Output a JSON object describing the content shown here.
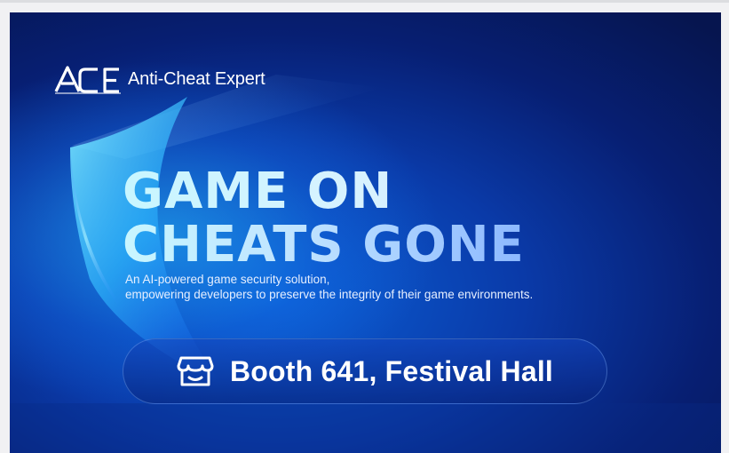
{
  "brand": {
    "logo_letters": "ACE",
    "name": "Anti-Cheat Expert"
  },
  "headline": {
    "line1": "GAME ON",
    "line2": "CHEATS GONE"
  },
  "subtitle": {
    "line1": "An AI-powered game security solution,",
    "line2": "empowering developers to preserve the integrity of their game environments."
  },
  "booth": {
    "icon": "storefront-icon",
    "label": "Booth 641, Festival Hall"
  },
  "colors": {
    "background_deep": "#06154f",
    "background_mid": "#0b5fd6",
    "glow": "#28beff",
    "headline": "#c9f4ff",
    "text": "#ffffff"
  }
}
